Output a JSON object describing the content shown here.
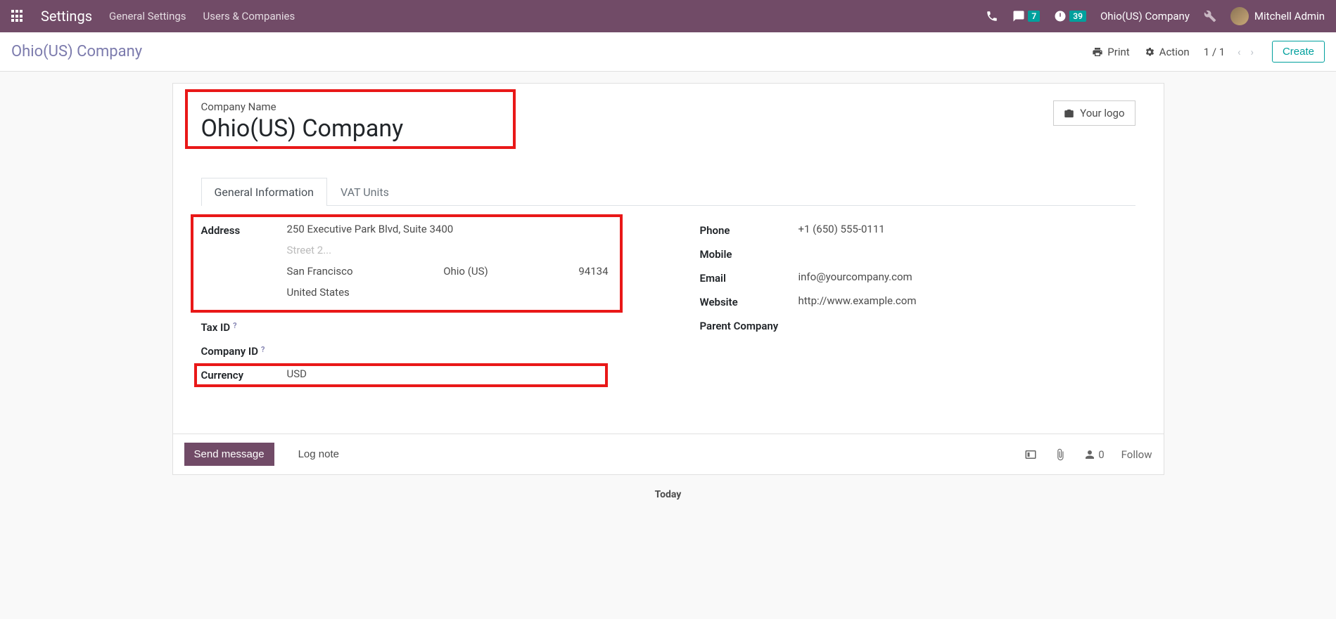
{
  "topnav": {
    "appTitle": "Settings",
    "menu": [
      "General Settings",
      "Users & Companies"
    ],
    "messagesBadge": "7",
    "activitiesBadge": "39",
    "company": "Ohio(US) Company",
    "user": "Mitchell Admin"
  },
  "controlPanel": {
    "breadcrumb": "Ohio(US) Company",
    "print": "Print",
    "action": "Action",
    "pager": "1 / 1",
    "create": "Create"
  },
  "form": {
    "companyNameLabel": "Company Name",
    "companyName": "Ohio(US) Company",
    "yourLogo": "Your logo",
    "tabs": {
      "general": "General Information",
      "vat": "VAT Units"
    },
    "left": {
      "addressLabel": "Address",
      "street": "250 Executive Park Blvd, Suite 3400",
      "street2Placeholder": "Street 2...",
      "city": "San Francisco",
      "state": "Ohio (US)",
      "zip": "94134",
      "country": "United States",
      "taxIdLabel": "Tax ID",
      "companyIdLabel": "Company ID",
      "currencyLabel": "Currency",
      "currency": "USD",
      "helpGlyph": "?"
    },
    "right": {
      "phoneLabel": "Phone",
      "phone": "+1 (650) 555-0111",
      "mobileLabel": "Mobile",
      "mobile": "",
      "emailLabel": "Email",
      "email": "info@yourcompany.com",
      "websiteLabel": "Website",
      "website": "http://www.example.com",
      "parentLabel": "Parent Company",
      "parent": ""
    }
  },
  "chatter": {
    "sendMessage": "Send message",
    "logNote": "Log note",
    "followerCount": "0",
    "follow": "Follow",
    "today": "Today"
  }
}
